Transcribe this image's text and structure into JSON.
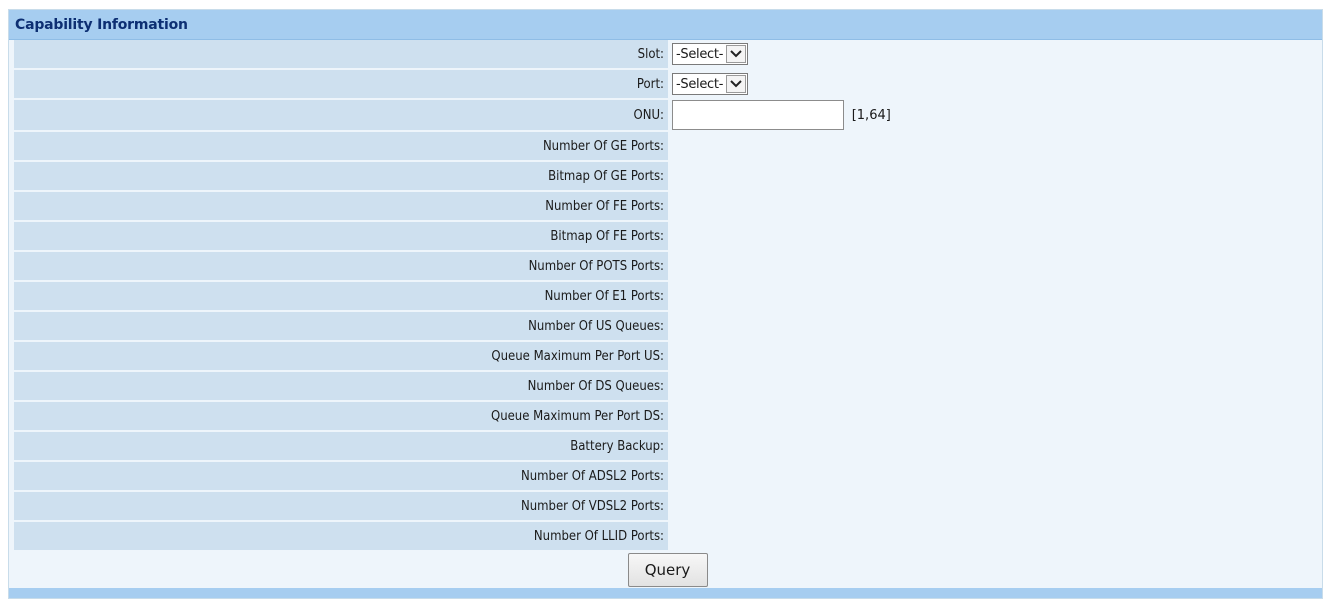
{
  "panel": {
    "title": "Capability Information"
  },
  "form": {
    "slot_label": "Slot:",
    "slot_value": "-Select-",
    "port_label": "Port:",
    "port_value": "-Select-",
    "onu_label": "ONU:",
    "onu_value": "",
    "onu_range": "[1,64]"
  },
  "fields": [
    {
      "label": "Number Of GE Ports:",
      "value": ""
    },
    {
      "label": "Bitmap Of GE Ports:",
      "value": ""
    },
    {
      "label": "Number Of FE Ports:",
      "value": ""
    },
    {
      "label": "Bitmap Of FE Ports:",
      "value": ""
    },
    {
      "label": "Number Of POTS Ports:",
      "value": ""
    },
    {
      "label": "Number Of E1 Ports:",
      "value": ""
    },
    {
      "label": "Number Of US Queues:",
      "value": ""
    },
    {
      "label": "Queue Maximum Per Port US:",
      "value": ""
    },
    {
      "label": "Number Of DS Queues:",
      "value": ""
    },
    {
      "label": "Queue Maximum Per Port DS:",
      "value": ""
    },
    {
      "label": "Battery Backup:",
      "value": ""
    },
    {
      "label": "Number Of ADSL2 Ports:",
      "value": ""
    },
    {
      "label": "Number Of VDSL2 Ports:",
      "value": ""
    },
    {
      "label": "Number Of LLID Ports:",
      "value": ""
    }
  ],
  "actions": {
    "query_label": "Query"
  },
  "icons": {
    "select_arrow": "chevron-down-icon"
  },
  "colors": {
    "header_bg": "#a6cdf0",
    "label_bg": "#cee0ef",
    "value_bg": "#eef5fb",
    "title_text": "#0d2f73"
  }
}
